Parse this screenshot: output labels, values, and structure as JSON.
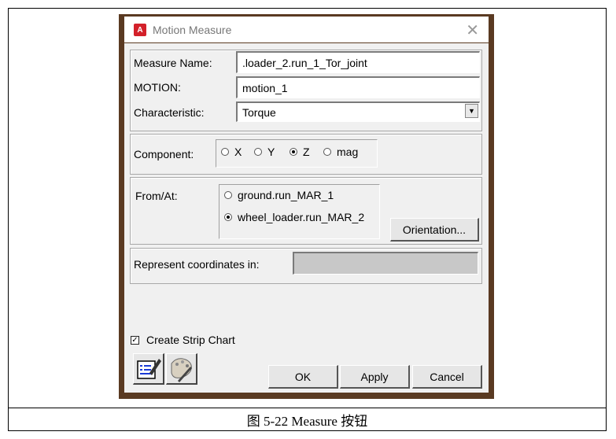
{
  "window": {
    "title": "Motion Measure",
    "icon": "app-logo-icon",
    "app_letter": "A"
  },
  "fields": {
    "measure_name": {
      "label": "Measure Name:",
      "value": ".loader_2.run_1_Tor_joint"
    },
    "motion": {
      "label": "MOTION:",
      "value": "motion_1"
    },
    "characteristic": {
      "label": "Characteristic:",
      "value": "Torque"
    }
  },
  "component": {
    "label": "Component:",
    "options": [
      "X",
      "Y",
      "Z",
      "mag"
    ],
    "selected": "Z"
  },
  "from_at": {
    "label": "From/At:",
    "options": [
      "ground.run_MAR_1",
      "wheel_loader.run_MAR_2"
    ],
    "selected": "wheel_loader.run_MAR_2",
    "orientation_button": "Orientation..."
  },
  "represent": {
    "label": "Represent coordinates in:",
    "value": ""
  },
  "strip_chart": {
    "label": "Create Strip Chart",
    "checked": true
  },
  "buttons": {
    "ok": "OK",
    "apply": "Apply",
    "cancel": "Cancel"
  },
  "caption": "图 5-22 Measure 按钮"
}
